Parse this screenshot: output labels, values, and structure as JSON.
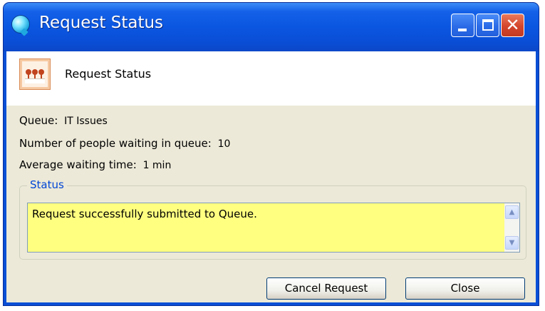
{
  "window": {
    "title": "Request Status",
    "controls": {
      "minimize": "minimize",
      "maximize": "maximize",
      "close": "✕"
    }
  },
  "header": {
    "title": "Request Status",
    "icon": "queue-people-icon"
  },
  "info": {
    "queue_label": "Queue:",
    "queue_value": "IT Issues",
    "waiting_label": "Number of people waiting in queue:",
    "waiting_value": "10",
    "avg_label": "Average waiting time:",
    "avg_value": "1 min"
  },
  "status": {
    "legend": "Status",
    "message": "Request successfully submitted to Queue."
  },
  "buttons": {
    "cancel": "Cancel Request",
    "close": "Close"
  },
  "colors": {
    "titlebar": "#0b56e0",
    "status_bg": "#ffff80",
    "legend": "#0046d5",
    "client_bg": "#ece9d8"
  }
}
